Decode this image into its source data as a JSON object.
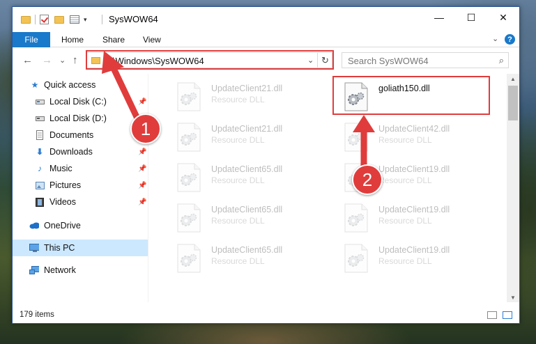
{
  "window": {
    "title": "SysWOW64",
    "minimize_glyph": "—",
    "maximize_glyph": "☐",
    "close_glyph": "✕"
  },
  "ribbon": {
    "file_tab": "File",
    "tabs": [
      "Home",
      "Share",
      "View"
    ],
    "expand_glyph": "⌄",
    "help_glyph": "?"
  },
  "nav": {
    "back_glyph": "←",
    "forward_glyph": "→",
    "recent_glyph": "⌄",
    "up_glyph": "↑",
    "address": "C:\\Windows\\SysWOW64",
    "address_drop_glyph": "⌄",
    "refresh_glyph": "↻",
    "search_placeholder": "Search SysWOW64",
    "search_icon_glyph": "⌕"
  },
  "sidebar": {
    "items": [
      {
        "label": "Quick access",
        "icon": "star-icon",
        "pinned": false,
        "indent": 0
      },
      {
        "label": "Local Disk (C:)",
        "icon": "drive-icon",
        "pinned": true,
        "indent": 1
      },
      {
        "label": "Local Disk (D:)",
        "icon": "drive-icon",
        "pinned": false,
        "indent": 1
      },
      {
        "label": "Documents",
        "icon": "documents-icon",
        "pinned": false,
        "indent": 1
      },
      {
        "label": "Downloads",
        "icon": "downloads-icon",
        "pinned": true,
        "indent": 1
      },
      {
        "label": "Music",
        "icon": "music-icon",
        "pinned": true,
        "indent": 1
      },
      {
        "label": "Pictures",
        "icon": "pictures-icon",
        "pinned": true,
        "indent": 1
      },
      {
        "label": "Videos",
        "icon": "videos-icon",
        "pinned": true,
        "indent": 1
      },
      {
        "label": "OneDrive",
        "icon": "cloud-icon",
        "pinned": false,
        "indent": 0
      },
      {
        "label": "This PC",
        "icon": "computer-icon",
        "pinned": false,
        "indent": 0,
        "selected": true
      },
      {
        "label": "Network",
        "icon": "network-icon",
        "pinned": false,
        "indent": 0
      }
    ],
    "pin_glyph": "📌"
  },
  "files": {
    "col1": [
      {
        "name": "UpdateClient21.dll",
        "type": "Resource DLL"
      },
      {
        "name": "UpdateClient21.dll",
        "type": "Resource DLL"
      },
      {
        "name": "UpdateClient65.dll",
        "type": "Resource DLL"
      },
      {
        "name": "UpdateClient65.dll",
        "type": "Resource DLL"
      },
      {
        "name": "UpdateClient65.dll",
        "type": "Resource DLL"
      }
    ],
    "col2": [
      {
        "name": "goliath150.dll",
        "type": ""
      },
      {
        "name": "UpdateClient42.dll",
        "type": "Resource DLL"
      },
      {
        "name": "UpdateClient19.dll",
        "type": "Resource DLL"
      },
      {
        "name": "UpdateClient19.dll",
        "type": "Resource DLL"
      },
      {
        "name": "UpdateClient19.dll",
        "type": "Resource DLL"
      }
    ]
  },
  "status": {
    "item_count": "179 items"
  },
  "annotations": {
    "marker1": "1",
    "marker2": "2",
    "color": "#e03c3c"
  }
}
